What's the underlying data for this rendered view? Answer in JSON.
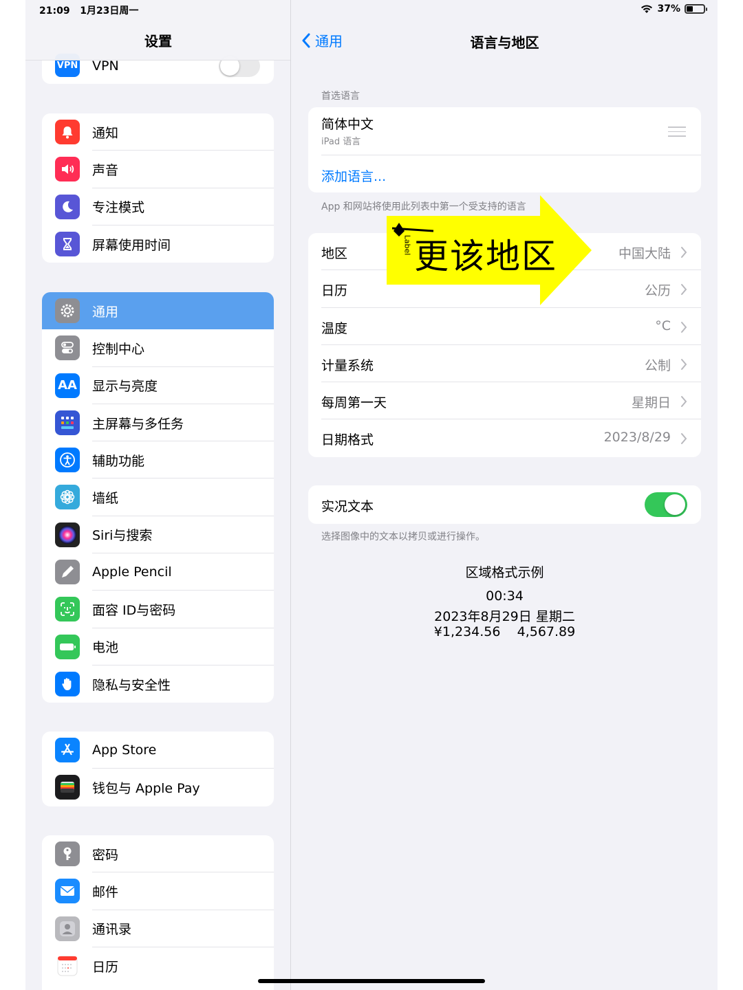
{
  "status": {
    "time": "21:09",
    "date": "1月23日周一",
    "battery": "37%",
    "battery_level": 0.37
  },
  "sidebar": {
    "title": "设置",
    "vpn": {
      "label": "VPN",
      "icon_text": "VPN",
      "enabled": false
    },
    "group1": [
      {
        "label": "通知",
        "icon": "bell-icon",
        "color": "#ff3b30"
      },
      {
        "label": "声音",
        "icon": "speaker-icon",
        "color": "#ff2d55"
      },
      {
        "label": "专注模式",
        "icon": "moon-icon",
        "color": "#5856d6"
      },
      {
        "label": "屏幕使用时间",
        "icon": "hourglass-icon",
        "color": "#5856d6"
      }
    ],
    "group2": [
      {
        "label": "通用",
        "icon": "gear-icon",
        "color": "#8e8e93",
        "selected": true
      },
      {
        "label": "控制中心",
        "icon": "switches-icon",
        "color": "#8e8e93"
      },
      {
        "label": "显示与亮度",
        "icon": "aa-icon",
        "color": "#007aff",
        "icon_text": "AA"
      },
      {
        "label": "主屏幕与多任务",
        "icon": "grid-icon",
        "color": "#3556d4"
      },
      {
        "label": "辅助功能",
        "icon": "accessibility-icon",
        "color": "#007aff"
      },
      {
        "label": "墙纸",
        "icon": "flower-icon",
        "color": "#35aadc"
      },
      {
        "label": "Siri与搜索",
        "icon": "siri-icon",
        "color": "#222222"
      },
      {
        "label": "Apple Pencil",
        "icon": "pencil-icon",
        "color": "#8e8e93"
      },
      {
        "label": "面容 ID与密码",
        "icon": "faceid-icon",
        "color": "#34c759"
      },
      {
        "label": "电池",
        "icon": "battery-icon",
        "color": "#34c759"
      },
      {
        "label": "隐私与安全性",
        "icon": "hand-icon",
        "color": "#007aff"
      }
    ],
    "group3": [
      {
        "label": "App Store",
        "icon": "appstore-icon",
        "color": "#0a84ff"
      },
      {
        "label": "钱包与 Apple Pay",
        "icon": "wallet-icon",
        "color": "#1c1c1e"
      }
    ],
    "group4": [
      {
        "label": "密码",
        "icon": "key-icon",
        "color": "#8e8e93"
      },
      {
        "label": "邮件",
        "icon": "mail-icon",
        "color": "#1a8cff"
      },
      {
        "label": "通讯录",
        "icon": "contacts-icon",
        "color": "#b9b9bd"
      },
      {
        "label": "日历",
        "icon": "calendar-icon",
        "color": "#ffffff"
      }
    ]
  },
  "detail": {
    "back_label": "通用",
    "title": "语言与地区",
    "preferred_header": "首选语言",
    "language_name": "简体中文",
    "language_sub": "iPad 语言",
    "add_language": "添加语言...",
    "preferred_footer": "App 和网站将使用此列表中第一个受支持的语言",
    "region_rows": [
      {
        "label": "地区",
        "value": "中国大陆"
      },
      {
        "label": "日历",
        "value": "公历"
      },
      {
        "label": "温度",
        "value": "°C"
      },
      {
        "label": "计量系统",
        "value": "公制"
      },
      {
        "label": "每周第一天",
        "value": "星期日"
      },
      {
        "label": "日期格式",
        "value": "2023/8/29"
      }
    ],
    "live_text": {
      "label": "实况文本",
      "enabled": true
    },
    "live_text_footer": "选择图像中的文本以拷贝或进行操作。",
    "example_title": "区域格式示例",
    "example_time": "00:34",
    "example_date": "2023年8月29日 星期二",
    "example_numbers": "¥1,234.56    4,567.89"
  },
  "annotation": {
    "text": "更该地区",
    "small": "Label",
    "color": "#ffff00"
  }
}
